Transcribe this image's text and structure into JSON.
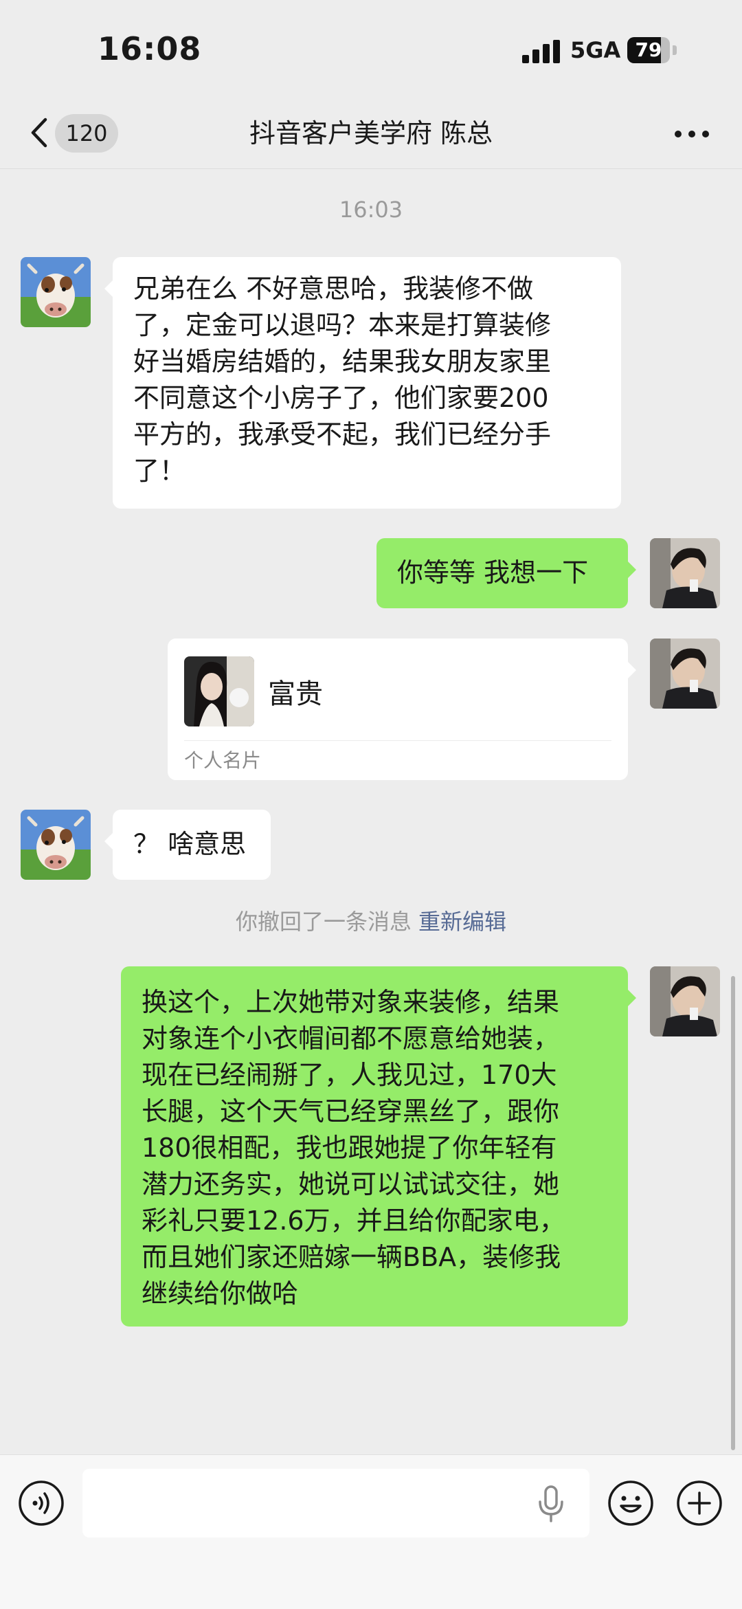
{
  "status_bar": {
    "time": "16:08",
    "network": "5GA",
    "battery_level": 79,
    "battery_text": "79"
  },
  "header": {
    "back_icon": "chevron-left-icon",
    "unread_count": "120",
    "title": "抖音客户美学府 陈总",
    "more_icon": "ellipsis-icon"
  },
  "messages": {
    "timestamp": "16:03",
    "m1": {
      "sender": "contact",
      "lines": [
        "兄弟在么 不好意思哈，我装修不做",
        "了，定金可以退吗？本来是打算装修",
        "好当婚房结婚的，结果我女朋友家里",
        "不同意这个小房子了，他们家要200",
        "平方的，我承受不起，我们已经分手",
        "了！"
      ]
    },
    "m2": {
      "sender": "me",
      "text": "你等等 我想一下"
    },
    "card": {
      "sender": "me",
      "name": "富贵",
      "type_label": "个人名片"
    },
    "m3": {
      "sender": "contact",
      "text": "？ 啥意思"
    },
    "recall": {
      "text": "你撤回了一条消息",
      "action": "重新编辑"
    },
    "m4": {
      "sender": "me",
      "lines": [
        "换这个，上次她带对象来装修，结果",
        "对象连个小衣帽间都不愿意给她装，",
        "现在已经闹掰了，人我见过，170大",
        "长腿，这个天气已经穿黑丝了，跟你",
        "180很相配，我也跟她提了你年轻有",
        "潜力还务实，她说可以试试交往，她",
        "彩礼只要12.6万，并且给你配家电，",
        "而且她们家还赔嫁一辆BBA，装修我",
        "继续给你做哈"
      ]
    }
  },
  "input_bar": {
    "voice_icon": "voice-mode-icon",
    "input_value": "",
    "mic_icon": "microphone-icon",
    "emoji_icon": "emoji-icon",
    "plus_icon": "plus-icon"
  },
  "colors": {
    "background": "#ededed",
    "my_bubble": "#95ec69",
    "their_bubble": "#ffffff",
    "link": "#576b95"
  }
}
